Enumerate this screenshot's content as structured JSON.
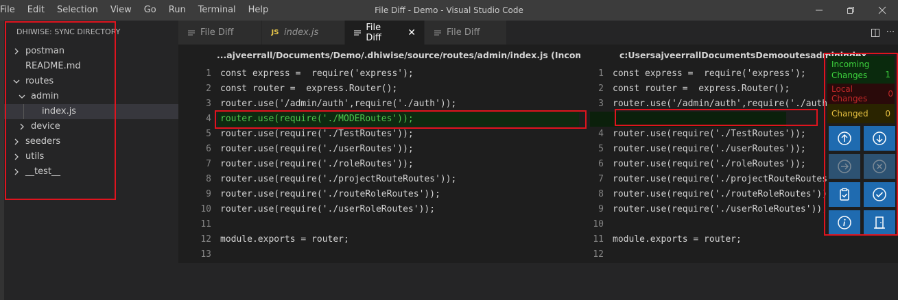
{
  "menu": [
    "File",
    "Edit",
    "Selection",
    "View",
    "Go",
    "Run",
    "Terminal",
    "Help"
  ],
  "window_title": "File Diff - Demo - Visual Studio Code",
  "sidebar": {
    "title": "DHIWISE: SYNC DIRECTORY",
    "items": [
      {
        "label": "postman",
        "type": "folder",
        "expanded": false,
        "depth": 0
      },
      {
        "label": "README.md",
        "type": "file",
        "depth": 0
      },
      {
        "label": "routes",
        "type": "folder",
        "expanded": true,
        "depth": 0
      },
      {
        "label": "admin",
        "type": "folder",
        "expanded": true,
        "depth": 1
      },
      {
        "label": "index.js",
        "type": "file",
        "depth": 2,
        "selected": true
      },
      {
        "label": "device",
        "type": "folder",
        "expanded": false,
        "depth": 1
      },
      {
        "label": "seeders",
        "type": "folder",
        "expanded": false,
        "depth": 0
      },
      {
        "label": "utils",
        "type": "folder",
        "expanded": false,
        "depth": 0
      },
      {
        "label": "__test__",
        "type": "folder",
        "expanded": false,
        "depth": 0
      }
    ]
  },
  "tabs": [
    {
      "label": "File Diff",
      "icon": "diff-icon",
      "active": false
    },
    {
      "label": "index.js",
      "icon": "js-icon",
      "active": false,
      "italic": true
    },
    {
      "label": "File Diff",
      "icon": "diff-icon",
      "active": true
    },
    {
      "label": "File Diff",
      "icon": "diff-icon",
      "active": false
    }
  ],
  "left_pane": {
    "header": "...ajveerrall/Documents/Demo/.dhiwise/source/routes/admin/index.js (Incoming file)",
    "lines": [
      {
        "n": "1",
        "code": "const express =  require('express');"
      },
      {
        "n": "2",
        "code": "const router =  express.Router();"
      },
      {
        "n": "3",
        "code": "router.use('/admin/auth',require('./auth'));"
      },
      {
        "n": "4",
        "code": "router.use(require('./MODERoutes'));",
        "added": true
      },
      {
        "n": "5",
        "code": "router.use(require('./TestRoutes'));"
      },
      {
        "n": "6",
        "code": "router.use(require('./userRoutes'));"
      },
      {
        "n": "7",
        "code": "router.use(require('./roleRoutes'));"
      },
      {
        "n": "8",
        "code": "router.use(require('./projectRouteRoutes'));"
      },
      {
        "n": "9",
        "code": "router.use(require('./routeRoleRoutes'));"
      },
      {
        "n": "10",
        "code": "router.use(require('./userRoleRoutes'));"
      },
      {
        "n": "11",
        "code": ""
      },
      {
        "n": "12",
        "code": "module.exports = router;"
      },
      {
        "n": "13",
        "code": ""
      }
    ]
  },
  "right_pane": {
    "header": "c:UsersajveerrallDocumentsDemooutesadminindex",
    "lines": [
      {
        "n": "1",
        "code": "const express =  require('express');"
      },
      {
        "n": "2",
        "code": "const router =  express.Router();"
      },
      {
        "n": "3",
        "code": "router.use('/admin/auth',require('./auth'));"
      },
      {
        "n": "",
        "code": "",
        "gap": true
      },
      {
        "n": "4",
        "code": "router.use(require('./TestRoutes'));"
      },
      {
        "n": "5",
        "code": "router.use(require('./userRoutes'));"
      },
      {
        "n": "6",
        "code": "router.use(require('./roleRoutes'));"
      },
      {
        "n": "7",
        "code": "router.use(require('./projectRouteRoutes'));"
      },
      {
        "n": "8",
        "code": "router.use(require('./routeRoleRoutes'));"
      },
      {
        "n": "9",
        "code": "router.use(require('./userRoleRoutes'));"
      },
      {
        "n": "10",
        "code": ""
      },
      {
        "n": "11",
        "code": "module.exports = router;"
      },
      {
        "n": "12",
        "code": ""
      }
    ]
  },
  "panel": {
    "incoming_label": "Incoming Changes",
    "incoming_count": "1",
    "local_label": "Local Changes",
    "local_count": "0",
    "changed_label": "Changed",
    "changed_count": "0",
    "buttons": [
      {
        "icon": "arrow-up-circle-icon",
        "enabled": true
      },
      {
        "icon": "arrow-down-circle-icon",
        "enabled": true
      },
      {
        "icon": "arrow-right-circle-icon",
        "enabled": false
      },
      {
        "icon": "close-circle-icon",
        "enabled": false
      },
      {
        "icon": "clipboard-check-icon",
        "enabled": true
      },
      {
        "icon": "check-circle-icon",
        "enabled": true
      },
      {
        "icon": "info-icon",
        "enabled": true
      },
      {
        "icon": "exit-door-icon",
        "enabled": true
      }
    ]
  },
  "colors": {
    "accent_red": "#e0141e",
    "added_green": "#4ec94e",
    "button_blue": "#1f6bb0"
  }
}
